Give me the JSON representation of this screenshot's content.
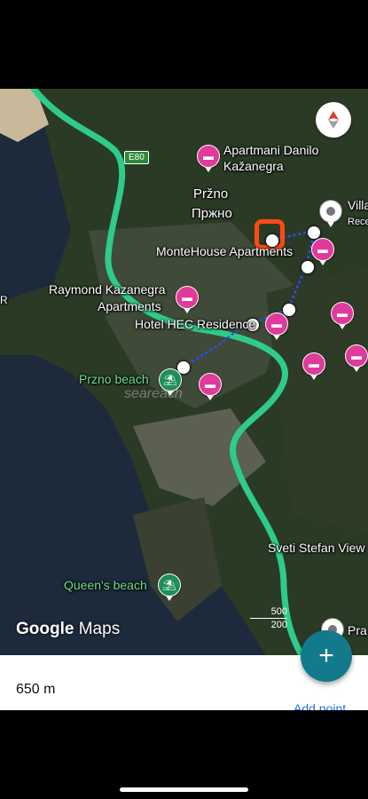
{
  "map": {
    "road_shield": "E80",
    "labels": {
      "apartmani_1": "Apartmani Danilo",
      "apartmani_2": "Kažanegra",
      "przno_lat": "Pržno",
      "przno_cyr": "Пржно",
      "villa": "Villa",
      "villa_sub": "Rece",
      "montehouse": "MonteHouse Apartments",
      "raymond_1": "Raymond Kazanegra",
      "raymond_2": "Apartments",
      "hotel_hec": "Hotel HEC Residence",
      "przno_beach": "Przno beach",
      "watermark": "seareach",
      "sveti_stefan": "Sveti Stefan View",
      "queens_beach": "Queen's beach",
      "pra": "Pra",
      "edge": "R"
    },
    "branding": {
      "google": "Google",
      "maps": "Maps"
    },
    "scale": {
      "top": "500",
      "bottom": "200"
    },
    "route_color": "#2ecc8a",
    "path_color": "#2b4dff",
    "selected_marker_color": "#ff4b12"
  },
  "bottom": {
    "distance": "650 m",
    "add_point": "Add point",
    "fab_icon": "+"
  }
}
